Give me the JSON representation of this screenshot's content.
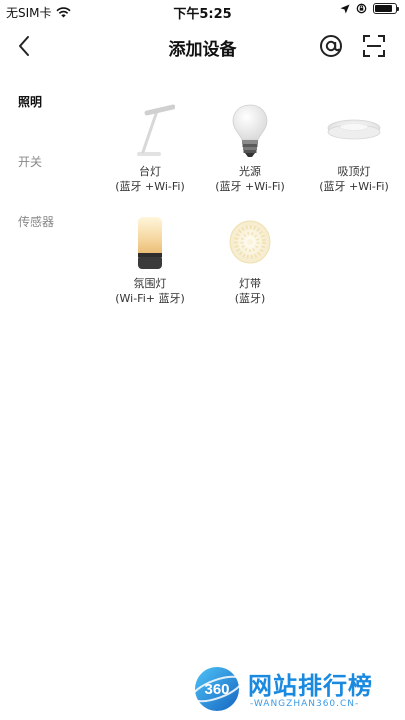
{
  "status_bar": {
    "carrier": "无SIM卡",
    "time": "下午5:25",
    "battery_level": 0.85
  },
  "nav": {
    "title": "添加设备",
    "icons": [
      "back-chevron-icon",
      "at-sign-icon",
      "scan-icon"
    ]
  },
  "categories": [
    {
      "label": "照明",
      "active": true
    },
    {
      "label": "开关",
      "active": false
    },
    {
      "label": "传感器",
      "active": false
    }
  ],
  "devices": [
    {
      "name": "台灯",
      "connectivity": "(蓝牙 +Wi-Fi)",
      "icon": "desk-lamp-icon"
    },
    {
      "name": "光源",
      "connectivity": "(蓝牙 +Wi-Fi)",
      "icon": "light-bulb-icon"
    },
    {
      "name": "吸顶灯",
      "connectivity": "(蓝牙 +Wi-Fi)",
      "icon": "ceiling-light-icon"
    },
    {
      "name": "氛围灯",
      "connectivity": "(Wi-Fi+ 蓝牙)",
      "icon": "ambient-lamp-icon"
    },
    {
      "name": "灯带",
      "connectivity": "(蓝牙)",
      "icon": "light-strip-icon"
    }
  ],
  "watermark": {
    "logo_text": "360",
    "title": "网站排行榜",
    "url": "-WANGZHAN360.CN-"
  },
  "colors": {
    "watermark_blue": "#1a8ae0",
    "active_category": "#111111",
    "inactive_category": "#888888"
  }
}
